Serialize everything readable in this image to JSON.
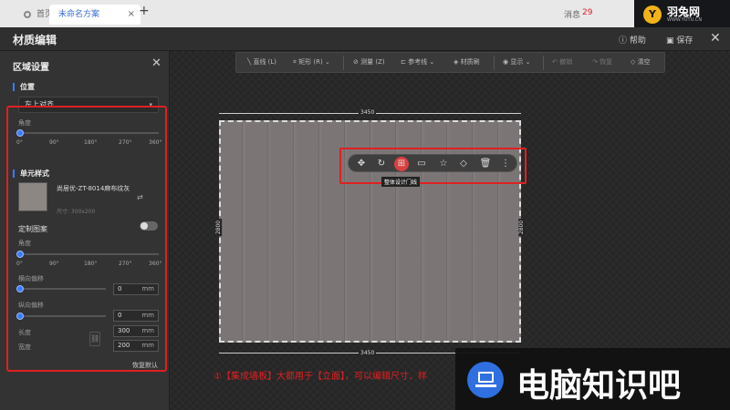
{
  "browser": {
    "home_tab": "首页",
    "active_tab": "未命名方案",
    "tab_close": "×",
    "new_tab": "+",
    "right_text": "消息",
    "right_count": "29"
  },
  "logo": {
    "text": "羽兔网",
    "sub": "WWW.YUTU.CN",
    "mark": "Y"
  },
  "app": {
    "title": "材质编辑",
    "help": "帮助",
    "save": "保存",
    "close": "✕"
  },
  "toolbar": {
    "items": [
      "直线 (L)",
      "矩形 (R)",
      "测量 (Z)",
      "参考线",
      "材质刷",
      "显示",
      "撤销",
      "恢复",
      "清空"
    ]
  },
  "panel": {
    "title": "区域设置",
    "position_label": "位置",
    "align_value": "左上对齐",
    "angle_label": "角度",
    "angle_ticks": [
      "0°",
      "90°",
      "180°",
      "270°",
      "360°"
    ],
    "unit_style_label": "单元样式",
    "material_name": "尚居优-ZT-8014麻布纹灰",
    "material_size": "尺寸: 300x200",
    "custom_pattern_label": "定制图案",
    "angle2_label": "角度",
    "h_offset_label": "横向偏移",
    "h_offset_value": "0",
    "v_offset_label": "纵向偏移",
    "v_offset_value": "0",
    "length_label": "长度",
    "length_value": "300",
    "width_label": "宽度",
    "width_value": "200",
    "unit": "mm",
    "reset": "恢复默认"
  },
  "canvas": {
    "dim_top": "3450",
    "dim_bottom": "3450",
    "dim_side": "2800",
    "tooltip": "整体设计门线",
    "caption": "①【集成墙板】大都用于【立面】，可以编辑尺寸、样",
    "float_icons": [
      "move-icon",
      "rotate-icon",
      "door-line-icon",
      "image-icon",
      "star-icon",
      "eraser-icon",
      "trash-icon",
      "more-icon"
    ]
  },
  "watermark": {
    "text": "电脑知识吧"
  },
  "colors": {
    "accent": "#3a7bff",
    "highlight": "#e02020"
  }
}
